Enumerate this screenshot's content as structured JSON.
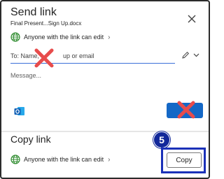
{
  "send_link": {
    "title": "Send link",
    "filename": "Final Present...Sign Up.docx",
    "permission": "Anyone with the link can edit",
    "to": {
      "label": "To: Name,",
      "value": "up or email"
    },
    "message_placeholder": "Message..."
  },
  "copy_link": {
    "title": "Copy link",
    "permission": "Anyone with the link can edit",
    "copy_label": "Copy"
  },
  "step_badge": "5",
  "colors": {
    "accent": "#1468c6",
    "highlight": "#1b31b8",
    "badge": "#12289a",
    "red_x": "#e74c4c",
    "globe": "#2e8b2e"
  },
  "icons": [
    "close-icon",
    "globe-icon",
    "pencil-icon",
    "chevron-down-icon",
    "outlook-icon",
    "red-x-mark-icon"
  ]
}
